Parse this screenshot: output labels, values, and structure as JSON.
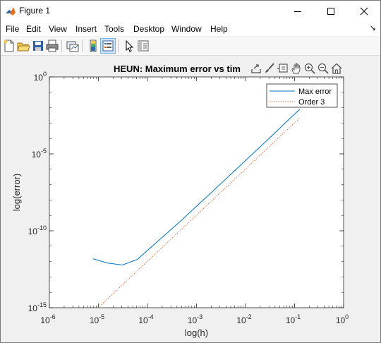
{
  "window": {
    "title": "Figure 1",
    "controls": [
      "minimize",
      "maximize",
      "close"
    ]
  },
  "menu": {
    "items": [
      "File",
      "Edit",
      "View",
      "Insert",
      "Tools",
      "Desktop",
      "Window",
      "Help"
    ],
    "dock_arrow": "↘"
  },
  "toolbar": {
    "icons": [
      "new-figure-icon",
      "open-file-icon",
      "save-icon",
      "print-icon",
      "link-plot-icon",
      "colorbar-icon",
      "legend-icon",
      "edit-plot-arrow-icon",
      "property-inspector-icon"
    ]
  },
  "axes_toolbar": {
    "icons": [
      "export-icon",
      "brush-icon",
      "data-tips-icon",
      "pan-hand-icon",
      "zoom-in-icon",
      "zoom-out-icon",
      "restore-view-home-icon"
    ]
  },
  "colors": {
    "max_error": "#0072BD",
    "order3": "#D95319",
    "axes_bg": "#ffffff",
    "figure_bg": "#f0f0f0"
  },
  "chart_data": {
    "type": "line",
    "title": "HEUN: Maximum error vs tim",
    "xlabel": "log(h)",
    "ylabel": "log(error)",
    "xscale": "log",
    "yscale": "log",
    "xlim": [
      1e-06,
      1
    ],
    "ylim": [
      1e-15,
      1
    ],
    "grid": false,
    "legend_position": "top-right",
    "x_ticks": [
      {
        "v": 1e-06,
        "base": "10",
        "exp": "-6"
      },
      {
        "v": 1e-05,
        "base": "10",
        "exp": "-5"
      },
      {
        "v": 0.0001,
        "base": "10",
        "exp": "-4"
      },
      {
        "v": 0.001,
        "base": "10",
        "exp": "-3"
      },
      {
        "v": 0.01,
        "base": "10",
        "exp": "-2"
      },
      {
        "v": 0.1,
        "base": "10",
        "exp": "-1"
      },
      {
        "v": 1,
        "base": "10",
        "exp": "0"
      }
    ],
    "y_ticks": [
      {
        "v": 1e-15,
        "base": "10",
        "exp": "-15"
      },
      {
        "v": 1e-10,
        "base": "10",
        "exp": "-10"
      },
      {
        "v": 1e-05,
        "base": "10",
        "exp": "-5"
      },
      {
        "v": 1,
        "base": "10",
        "exp": "0"
      }
    ],
    "series": [
      {
        "name": "Max error",
        "style": "solid",
        "x": [
          7.8e-06,
          1.56e-05,
          3.1e-05,
          6.25e-05,
          0.000125,
          0.00025,
          0.0005,
          0.001,
          0.002,
          0.004,
          0.008,
          0.016,
          0.032,
          0.064,
          0.128
        ],
        "y": [
          1.5e-12,
          8e-13,
          6e-13,
          1.4e-12,
          1e-11,
          7e-11,
          5e-10,
          4e-09,
          3e-08,
          2.4e-07,
          1.9e-06,
          1.5e-05,
          0.00012,
          0.001,
          0.008
        ]
      },
      {
        "name": "Order 3",
        "style": "dotted",
        "x": [
          7.8e-06,
          1e-05,
          0.0001,
          0.001,
          0.01,
          0.128
        ],
        "y": [
          5e-16,
          1.05e-15,
          1.05e-12,
          1.05e-09,
          1.05e-06,
          0.0022
        ]
      }
    ]
  }
}
